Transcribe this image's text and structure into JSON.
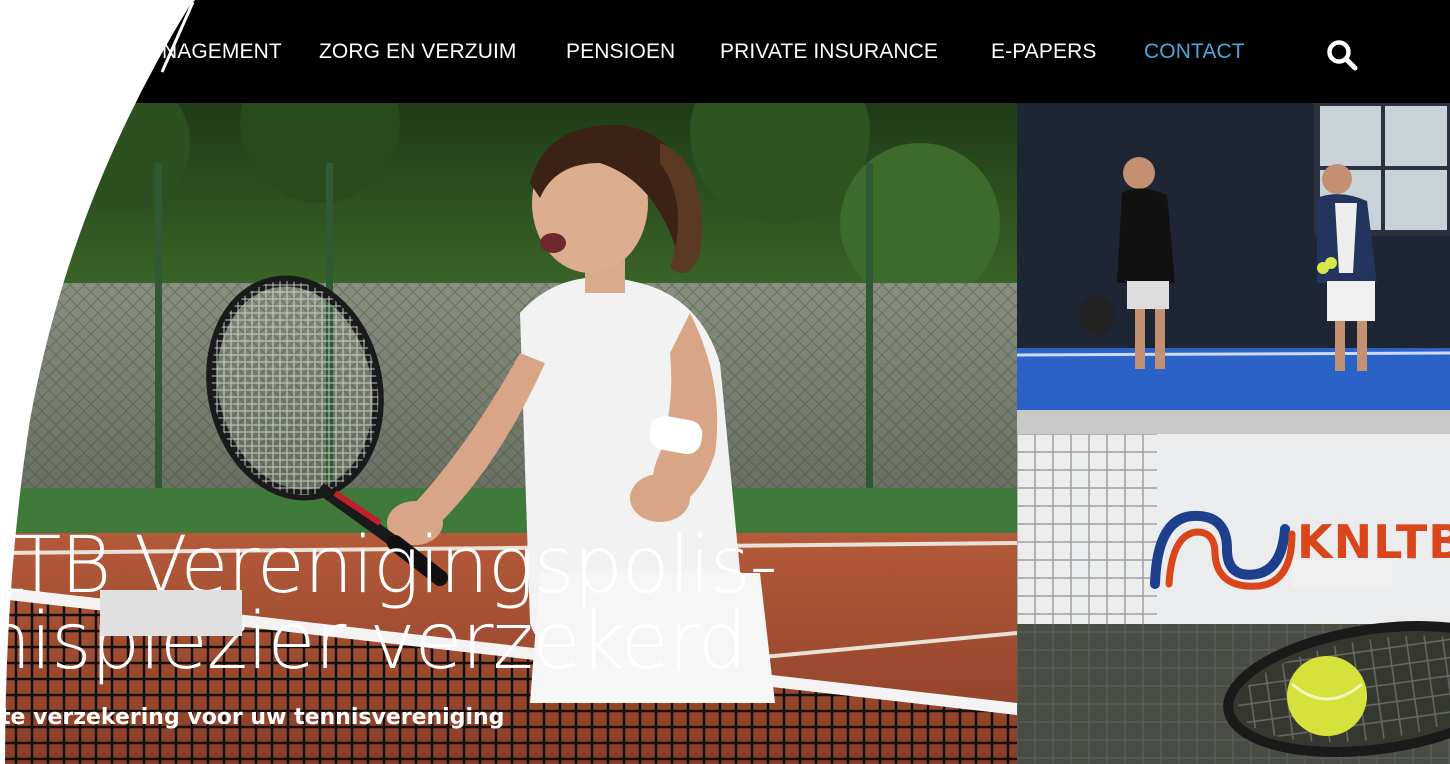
{
  "nav": {
    "items": [
      {
        "label": "NAGEMENT",
        "active": false
      },
      {
        "label": "ZORG EN VERZUIM",
        "active": false
      },
      {
        "label": "PENSIOEN",
        "active": false
      },
      {
        "label": "PRIVATE INSURANCE",
        "active": false
      },
      {
        "label": "E-PAPERS",
        "active": false
      },
      {
        "label": "CONTACT",
        "active": true
      }
    ],
    "search_icon": "search-icon"
  },
  "hero": {
    "title_line1": "LTB Verenigingspolis-",
    "title_line2": "nisplezier verzekerd",
    "subtitle": "te verzekering voor uw tennisvereniging"
  },
  "tiles": {
    "logo_text": "KNLTB"
  },
  "colors": {
    "nav_bg": "#000000",
    "nav_text": "#ffffff",
    "nav_active": "#4aa8dd",
    "logo_orange": "#d9461c",
    "logo_blue": "#1d3f8c"
  }
}
